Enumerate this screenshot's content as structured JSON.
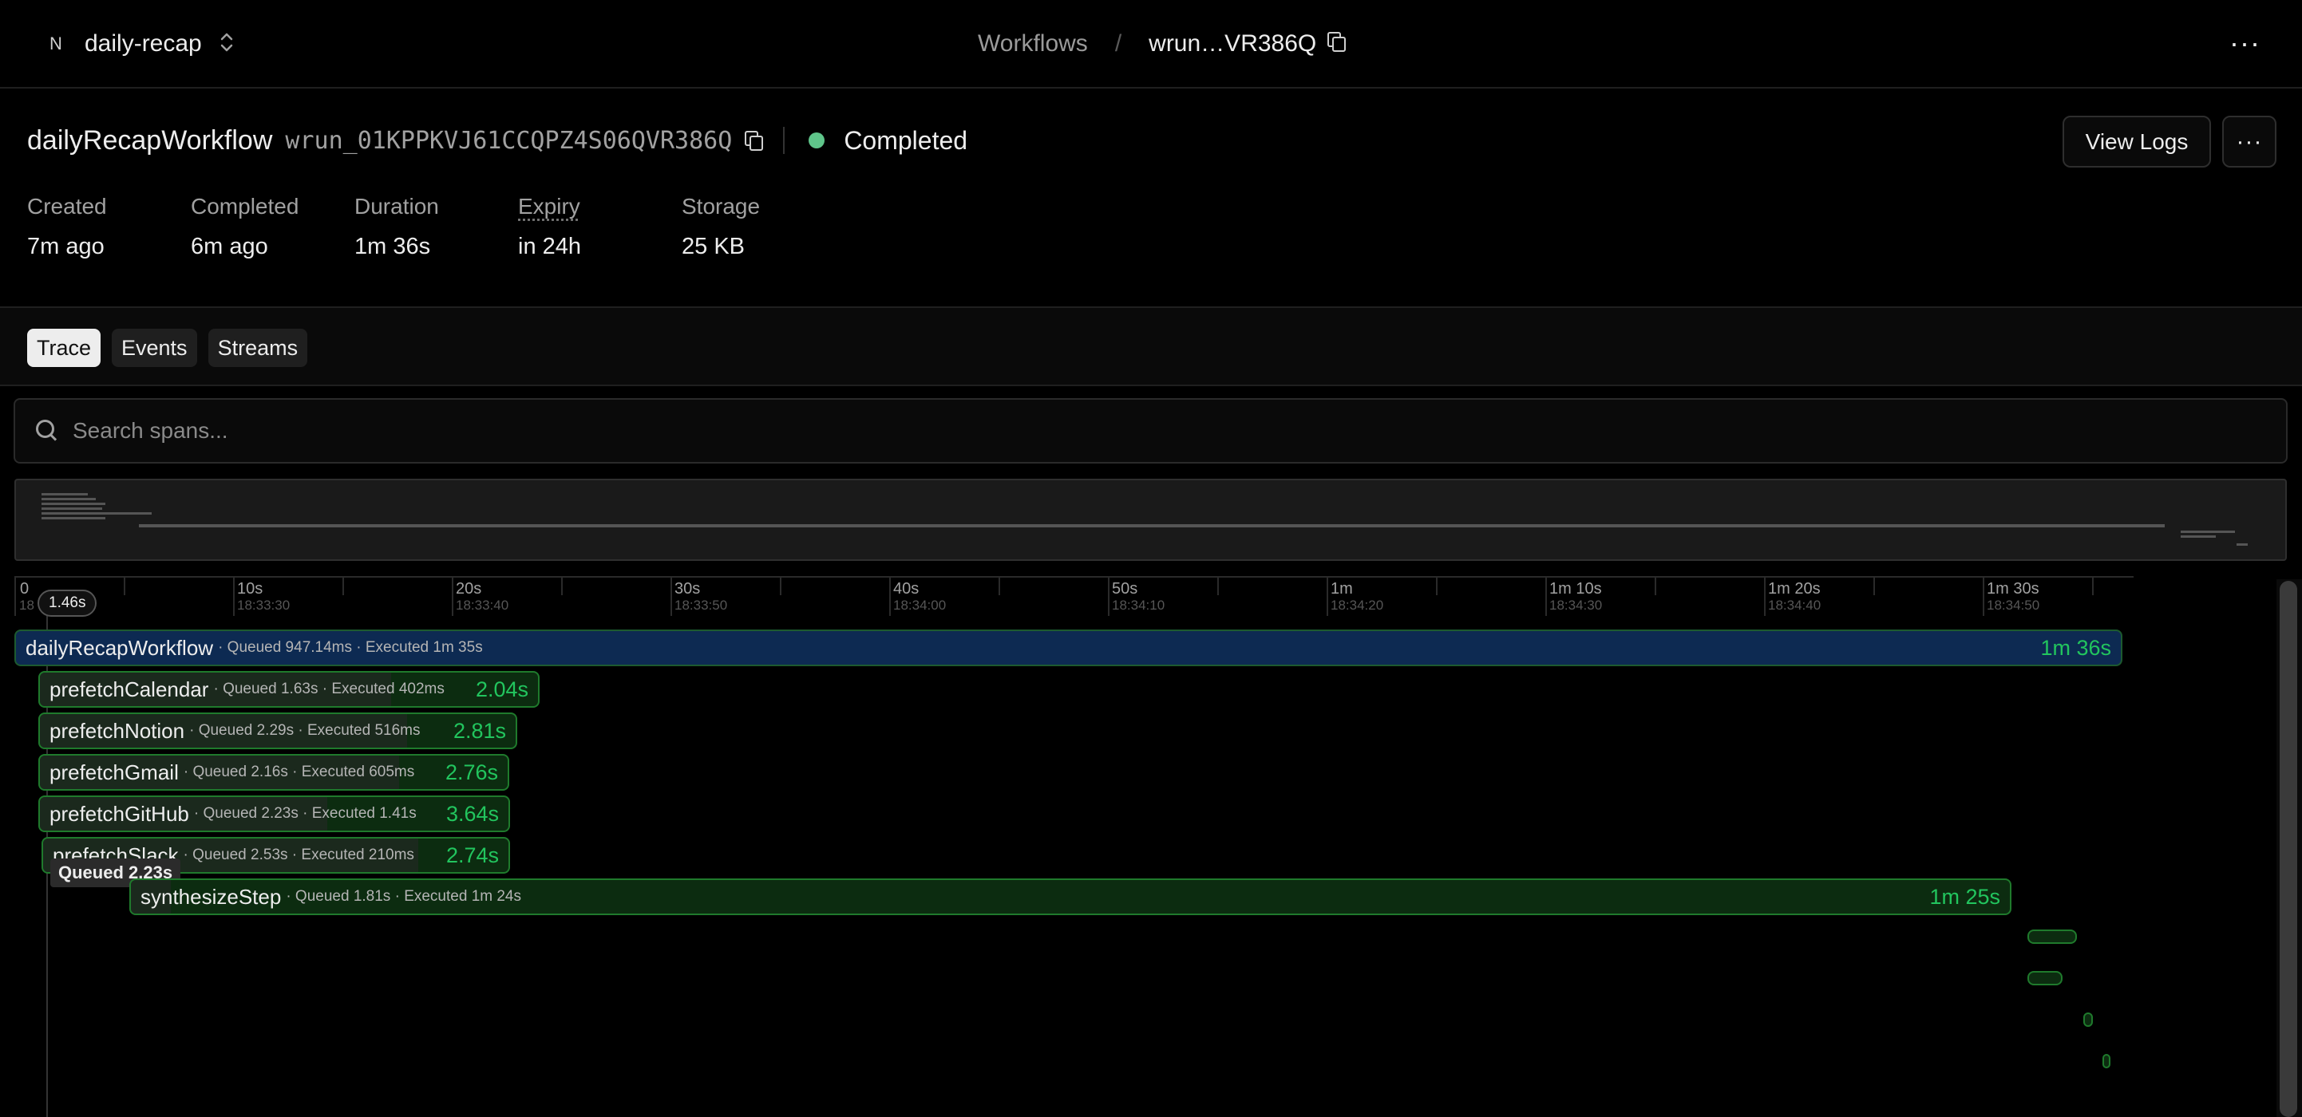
{
  "topbar": {
    "project_logo": "N",
    "project_name": "daily-recap",
    "chevron_icon": "chevrons-up-down-icon",
    "breadcrumb_workflows": "Workflows",
    "breadcrumb_sep": "/",
    "breadcrumb_run": "wrun…VR386Q",
    "menu_icon": "more-horizontal-icon",
    "menu_glyph": "···"
  },
  "run": {
    "title": "dailyRecapWorkflow",
    "id": "wrun_01KPPKVJ61CCQPZ4S06QVR386Q",
    "status": "Completed",
    "status_color": "#5fc58a",
    "view_logs_label": "View Logs",
    "more_glyph": "···"
  },
  "meta": [
    {
      "label": "Created",
      "value": "7m ago"
    },
    {
      "label": "Completed",
      "value": "6m ago"
    },
    {
      "label": "Duration",
      "value": "1m 36s"
    },
    {
      "label": "Expiry",
      "value": "in 24h"
    },
    {
      "label": "Storage",
      "value": "25 KB"
    }
  ],
  "tabs": [
    {
      "label": "Trace",
      "active": true
    },
    {
      "label": "Events",
      "active": false
    },
    {
      "label": "Streams",
      "active": false
    }
  ],
  "search": {
    "placeholder": "Search spans..."
  },
  "timeline": {
    "cursor_label": "1.46s",
    "ticks": [
      {
        "label": "0",
        "sub": "18"
      },
      {
        "label": "10s",
        "sub": "18:33:30"
      },
      {
        "label": "20s",
        "sub": "18:33:40"
      },
      {
        "label": "30s",
        "sub": "18:33:50"
      },
      {
        "label": "40s",
        "sub": "18:34:00"
      },
      {
        "label": "50s",
        "sub": "18:34:10"
      },
      {
        "label": "1m",
        "sub": "18:34:20"
      },
      {
        "label": "1m 10s",
        "sub": "18:34:30"
      },
      {
        "label": "1m 20s",
        "sub": "18:34:40"
      },
      {
        "label": "1m 30s",
        "sub": "18:34:50"
      }
    ],
    "tooltip": "Queued 2.23s"
  },
  "spans": [
    {
      "name": "dailyRecapWorkflow",
      "detail": "· Queued 947.14ms · Executed 1m 35s",
      "duration": "1m 36s",
      "root": true
    },
    {
      "name": "prefetchCalendar",
      "detail": "· Queued 1.63s · Executed 402ms",
      "duration": "2.04s"
    },
    {
      "name": "prefetchNotion",
      "detail": "· Queued 2.29s · Executed 516ms",
      "duration": "2.81s"
    },
    {
      "name": "prefetchGmail",
      "detail": "· Queued 2.16s · Executed 605ms",
      "duration": "2.76s"
    },
    {
      "name": "prefetchGitHub",
      "detail": "· Queued 2.23s · Executed 1.41s",
      "duration": "3.64s"
    },
    {
      "name": "prefetchSlack",
      "detail": "· Queued 2.53s · Executed 210ms",
      "duration": "2.74s"
    },
    {
      "name": "synthesizeStep",
      "detail": "· Queued 1.81s · Executed 1m 24s",
      "duration": "1m 25s"
    }
  ]
}
